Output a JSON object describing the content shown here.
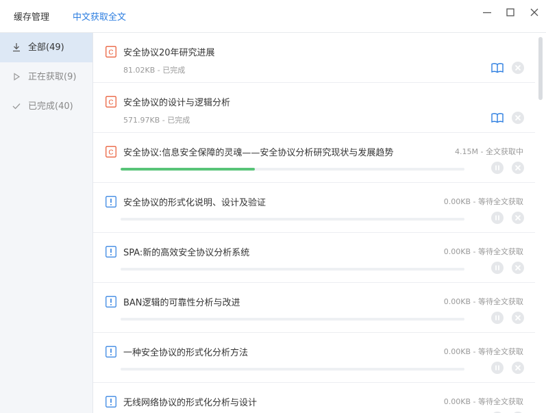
{
  "header": {
    "tab_cache": "缓存管理",
    "tab_fulltext": "中文获取全文"
  },
  "sidebar": {
    "items": [
      {
        "label": "全部(49)",
        "icon": "download-icon",
        "active": true
      },
      {
        "label": "正在获取(9)",
        "icon": "play-icon",
        "active": false
      },
      {
        "label": "已完成(40)",
        "icon": "check-icon",
        "active": false
      }
    ]
  },
  "items": [
    {
      "title": "安全协议20年研究进展",
      "meta": "81.02KB - 已完成",
      "state": "done"
    },
    {
      "title": "安全协议的设计与逻辑分析",
      "meta": "571.97KB - 已完成",
      "state": "done"
    },
    {
      "title": "安全协议:信息安全保障的灵魂——安全协议分析研究现状与发展趋势",
      "status": "4.15M - 全文获取中",
      "state": "downloading",
      "progress": 0.39
    },
    {
      "title": "安全协议的形式化说明、设计及验证",
      "status": "0.00KB - 等待全文获取",
      "state": "waiting",
      "progress": 0
    },
    {
      "title": "SPA:新的高效安全协议分析系统",
      "status": "0.00KB - 等待全文获取",
      "state": "waiting",
      "progress": 0
    },
    {
      "title": "BAN逻辑的可靠性分析与改进",
      "status": "0.00KB - 等待全文获取",
      "state": "waiting",
      "progress": 0
    },
    {
      "title": "一种安全协议的形式化分析方法",
      "status": "0.00KB - 等待全文获取",
      "state": "waiting",
      "progress": 0
    },
    {
      "title": "无线网络协议的形式化分析与设计",
      "status": "0.00KB - 等待全文获取",
      "state": "waiting",
      "progress": 0
    }
  ],
  "colors": {
    "accent": "#2b7de0",
    "progress": "#58c478",
    "cached_icon": "#e8542e",
    "pending_icon": "#2b7de0"
  }
}
